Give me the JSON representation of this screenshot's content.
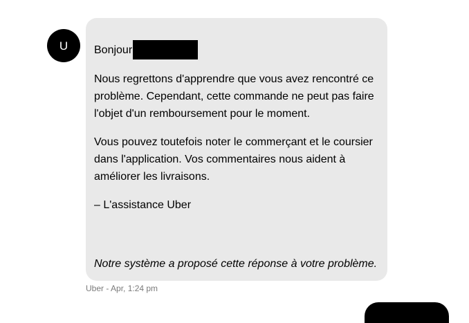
{
  "message": {
    "avatar_initial": "U",
    "greeting": "Bonjour",
    "paragraphs": [
      "Nous regrettons d'apprendre que vous avez rencontré ce problème. Cependant, cette commande ne peut pas faire l'objet d'un remboursement pour le moment.",
      "Vous pouvez toutefois noter le commerçant et le coursier dans l'application. Vos commentaires nous aident à améliorer les livraisons."
    ],
    "signature": "– L'assistance Uber",
    "auto_note": "Notre système a proposé cette réponse à votre problème.",
    "meta": "Uber - Apr, 1:24 pm"
  },
  "colors": {
    "bubble_bg": "#e9e9e9",
    "avatar_bg": "#000000",
    "meta_text": "#7a7a7a"
  }
}
